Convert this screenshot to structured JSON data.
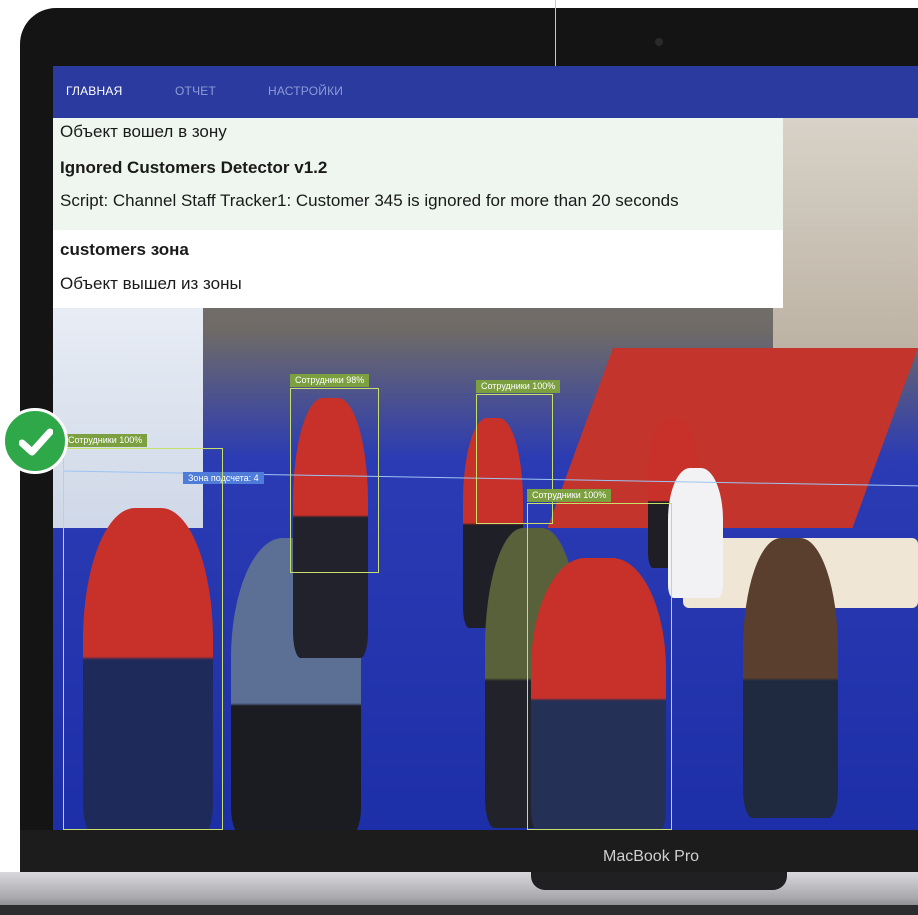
{
  "nav": {
    "items": [
      {
        "label": "ГЛАВНАЯ",
        "active": true
      },
      {
        "label": "ОТЧЕТ",
        "active": false
      },
      {
        "label": "НАСТРОЙКИ",
        "active": false
      }
    ]
  },
  "events": {
    "line1": "Объект вошел в зону",
    "line2": "Ignored Customers Detector v1.2",
    "line3": "Script: Channel Staff Tracker1: Customer 345 is ignored for more than 20 seconds",
    "line4": "customers зона",
    "line5": "Объект вышел из зоны"
  },
  "detections": {
    "box1": "Сотрудники 100%",
    "box2": "Сотрудники 98%",
    "box3": "Сотрудники 100%",
    "box4": "Сотрудники 100%",
    "zone": "Зона подсчета: 4"
  },
  "device": {
    "brand": "MacBook Pro"
  },
  "icons": {
    "status": "check-circle-icon"
  },
  "colors": {
    "nav_bg": "#2a3a9e",
    "accent_green": "#2fa84a",
    "detection_box": "#c8e06a",
    "zone_line": "#9cc4f2"
  }
}
